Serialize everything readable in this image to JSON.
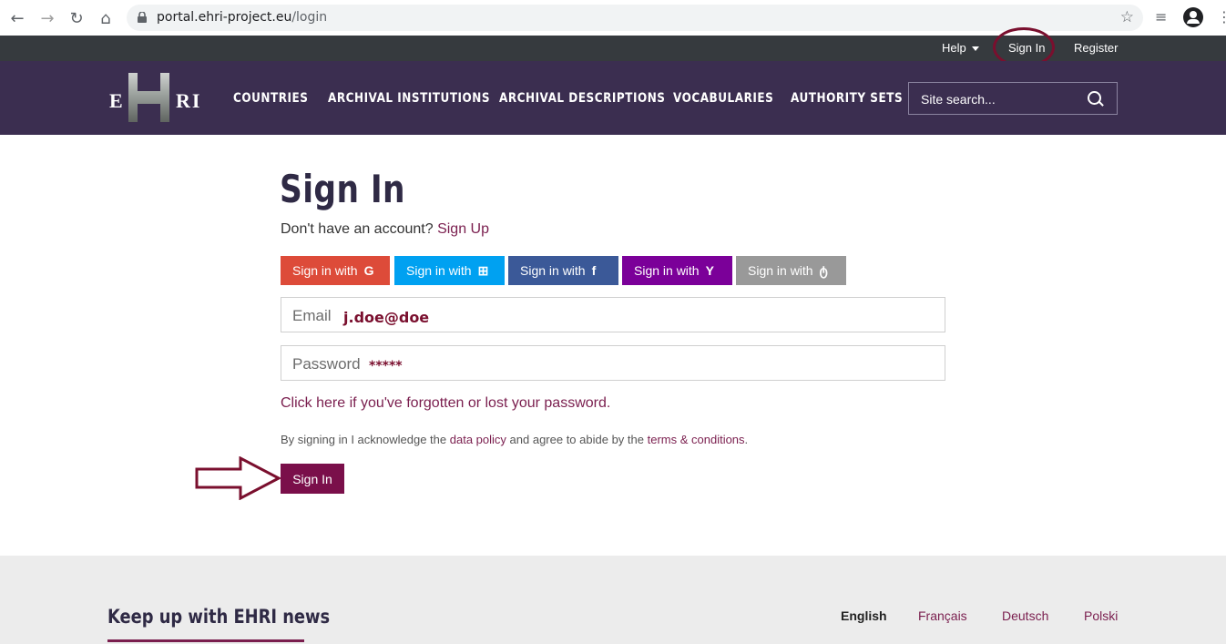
{
  "browser": {
    "url_domain": "portal.ehri-project.eu",
    "url_path": "/login",
    "back_icon": "←",
    "forward_icon": "→",
    "reload_icon": "↻",
    "home_icon": "⌂",
    "star_icon": "☆",
    "playlist_icon": "≡",
    "profile_icon": "●",
    "menu_icon": "⋮"
  },
  "utilbar": {
    "help": "Help",
    "sign_in": "Sign In",
    "register": "Register"
  },
  "nav": {
    "logo_left": "E",
    "logo_right": "RI",
    "items": [
      "COUNTRIES",
      "ARCHIVAL INSTITUTIONS",
      "ARCHIVAL DESCRIPTIONS",
      "VOCABULARIES",
      "AUTHORITY SETS"
    ],
    "search_placeholder": "Site search..."
  },
  "main": {
    "title": "Sign In",
    "no_account": "Don't have an account?",
    "sign_up": "Sign Up",
    "social": [
      {
        "label": "Sign in with",
        "icon": "G",
        "color": "#dd4b39"
      },
      {
        "label": "Sign in with",
        "icon": "⊞",
        "color": "#00a1f1"
      },
      {
        "label": "Sign in with",
        "icon": "f",
        "color": "#3b5998"
      },
      {
        "label": "Sign in with",
        "icon": "Y",
        "color": "#7b0099"
      },
      {
        "label": "Sign in with",
        "icon": "ტ",
        "color": "#999999"
      }
    ],
    "email_label": "Email",
    "email_value": "j.doe@doe",
    "password_label": "Password",
    "password_value": "*****",
    "forgot": "Click here if you've forgotten or lost your password.",
    "ack_1": "By signing in I acknowledge the",
    "ack_data_policy": "data policy",
    "ack_2": "and agree to abide by the",
    "ack_terms": "terms & conditions",
    "ack_end": ".",
    "submit": "Sign In"
  },
  "footer": {
    "news": "Keep up with EHRI news",
    "languages": [
      "English",
      "Français",
      "Deutsch",
      "Polski"
    ]
  },
  "colors": {
    "nav_bg": "#3b2e50",
    "util_bg": "#363a3e",
    "accent": "#7a0f4a",
    "link": "#7a1e4e"
  }
}
